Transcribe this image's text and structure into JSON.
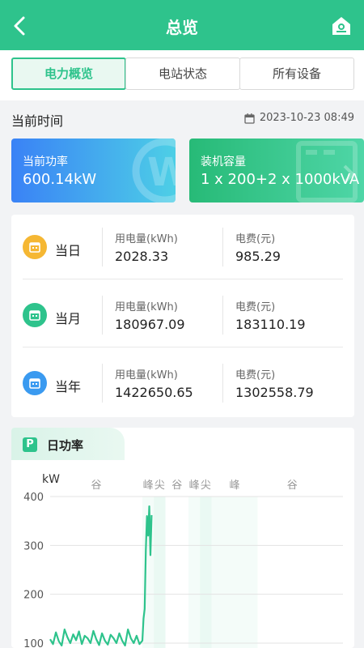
{
  "header": {
    "title": "总览",
    "back_icon": "chevron-left-icon",
    "right_icon": "home-icon"
  },
  "tabs": [
    {
      "label": "电力概览",
      "active": true
    },
    {
      "label": "电站状态",
      "active": false
    },
    {
      "label": "所有设备",
      "active": false
    }
  ],
  "time": {
    "label": "当前时间",
    "value": "2023-10-23 08:49"
  },
  "cards": {
    "power": {
      "label": "当前功率",
      "value": "600.14kW"
    },
    "capacity": {
      "label": "装机容量",
      "value": "1 x 200+2 x 1000kVA"
    }
  },
  "stats": [
    {
      "period": "当日",
      "usage_label": "用电量(kWh)",
      "usage": "2028.33",
      "fee_label": "电费(元)",
      "fee": "985.29",
      "color": "#f5b733"
    },
    {
      "period": "当月",
      "usage_label": "用电量(kWh)",
      "usage": "180967.09",
      "fee_label": "电费(元)",
      "fee": "183110.19",
      "color": "#2ec38c"
    },
    {
      "period": "当年",
      "usage_label": "用电量(kWh)",
      "usage": "1422650.65",
      "fee_label": "电费(元)",
      "fee": "1302558.79",
      "color": "#3a9af0"
    }
  ],
  "chart_section": {
    "title": "日功率",
    "icon_letter": "P"
  },
  "chart_data": {
    "type": "line",
    "ylabel": "kW",
    "ylim": [
      90,
      400
    ],
    "yticks": [
      100,
      200,
      300,
      400
    ],
    "grid": true,
    "period_bands": [
      {
        "label": "谷",
        "start_h": 0,
        "end_h": 8,
        "shade": "none"
      },
      {
        "label": "峰",
        "start_h": 8,
        "end_h": 9,
        "shade": "light"
      },
      {
        "label": "尖",
        "start_h": 9,
        "end_h": 10,
        "shade": "medium"
      },
      {
        "label": "谷",
        "start_h": 10,
        "end_h": 12,
        "shade": "none"
      },
      {
        "label": "峰",
        "start_h": 12,
        "end_h": 13,
        "shade": "light"
      },
      {
        "label": "尖",
        "start_h": 13,
        "end_h": 14,
        "shade": "medium"
      },
      {
        "label": "峰",
        "start_h": 14,
        "end_h": 18,
        "shade": "light"
      },
      {
        "label": "谷",
        "start_h": 18,
        "end_h": 24,
        "shade": "none"
      }
    ],
    "series": [
      {
        "color": "#2ec38c",
        "x_hours": [
          0,
          0.25,
          0.5,
          0.75,
          1,
          1.25,
          1.5,
          1.75,
          2,
          2.25,
          2.5,
          2.75,
          3,
          3.25,
          3.5,
          3.75,
          4,
          4.25,
          4.5,
          4.75,
          5,
          5.25,
          5.5,
          5.75,
          6,
          6.25,
          6.5,
          6.75,
          7,
          7.25,
          7.5,
          7.75,
          8,
          8.1,
          8.2,
          8.3,
          8.4,
          8.5,
          8.6,
          8.7,
          8.8
        ],
        "values": [
          108,
          98,
          122,
          104,
          95,
          128,
          112,
          100,
          118,
          106,
          124,
          98,
          115,
          110,
          100,
          125,
          108,
          96,
          120,
          105,
          97,
          117,
          110,
          100,
          120,
          105,
          95,
          128,
          110,
          100,
          115,
          98,
          105,
          150,
          170,
          290,
          360,
          320,
          380,
          280,
          362
        ]
      }
    ]
  }
}
